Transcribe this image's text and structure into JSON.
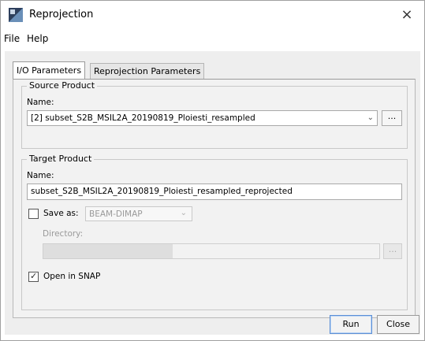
{
  "window": {
    "title": "Reprojection",
    "app_icon": "snap-app-icon",
    "close_glyph": "×"
  },
  "menu": {
    "items": [
      "File",
      "Help"
    ]
  },
  "tabs": [
    {
      "label": "I/O Parameters",
      "active": true
    },
    {
      "label": "Reprojection Parameters",
      "active": false
    }
  ],
  "source_product": {
    "legend": "Source Product",
    "name_label": "Name:",
    "selected": "[2] subset_S2B_MSIL2A_20190819_Ploiesti_resampled",
    "browse_label": "..."
  },
  "target_product": {
    "legend": "Target Product",
    "name_label": "Name:",
    "name_value": "subset_S2B_MSIL2A_20190819_Ploiesti_resampled_reprojected",
    "save_as_label": "Save as:",
    "save_as_checked": false,
    "format_value": "BEAM-DIMAP",
    "directory_label": "Directory:",
    "browse_label": "...",
    "open_in_snap_label": "Open in SNAP",
    "open_in_snap_checked": true
  },
  "buttons": {
    "run": "Run",
    "close": "Close"
  },
  "colors": {
    "run_focus_border": "#5b8fd6",
    "panel_bg": "#f2f2f2",
    "window_bg": "#eeeeee"
  }
}
